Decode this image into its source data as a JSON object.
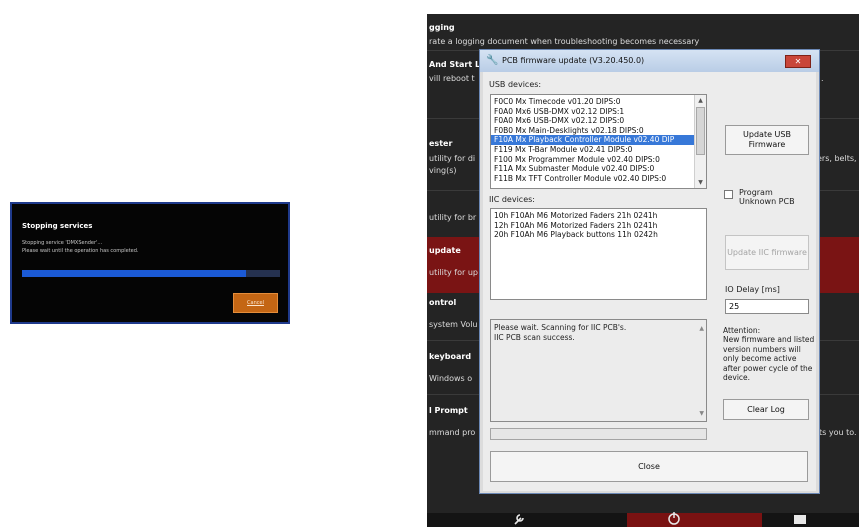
{
  "stopping_dialog": {
    "title": "Stopping services",
    "message_line1": "Stopping service 'DMXSender'...",
    "message_line2": "Please wait until the operation has completed.",
    "progress": 0.87,
    "cancel_label": "Cancel"
  },
  "settings": {
    "entries": [
      {
        "title": "gging",
        "desc": "rate a logging document when troubleshooting becomes necessary"
      },
      {
        "title": "And Start L",
        "desc": "vill reboot t"
      },
      {
        "title": "ester",
        "desc": "utility for di",
        "desc2": "ving(s)"
      },
      {
        "desc": "utility for br"
      },
      {
        "title": "update",
        "desc": "utility for up"
      },
      {
        "title": "ontrol",
        "desc": "system Volu"
      },
      {
        "title": "keyboard",
        "desc": "Windows o"
      },
      {
        "title": "l Prompt",
        "desc": "mmand pro"
      }
    ],
    "right_fragments": {
      "dot": ".",
      "faders": "ers, belts,",
      "you_to": "ts you to."
    },
    "taskbar": {
      "item1_icon": "wrench-icon",
      "item2_icon": "power-icon",
      "item3_icon": "keyboard-icon"
    }
  },
  "pcb_dialog": {
    "title": "PCB firmware update (V3.20.450.0)",
    "close_x": "✕",
    "usb_label": "USB devices:",
    "usb_devices": [
      "F0C0  Mx Timecode  v01.20  DIPS:0",
      "F0A0  Mx6 USB-DMX  v02.12  DIPS:1",
      "F0A0  Mx6 USB-DMX  v02.12  DIPS:0",
      "F0B0  Mx Main-Desklights  v02.18  DIPS:0",
      "F10A  Mx Playback Controller Module  v02.40  DIP",
      "F119  Mx T-Bar Module  v02.41  DIPS:0",
      "F100  Mx Programmer Module  v02.40  DIPS:0",
      "F11A  Mx Submaster Module  v02.40  DIPS:0",
      "F11B  Mx TFT Controller Module  v02.40  DIPS:0"
    ],
    "usb_selected_index": 4,
    "update_usb_label_1": "Update USB",
    "update_usb_label_2": "Firmware",
    "program_unknown_label_1": "Program",
    "program_unknown_label_2": "Unknown PCB",
    "iic_label": "IIC devices:",
    "iic_devices": [
      "10h  F10Ah  M6 Motorized Faders 21h  0241h",
      "12h  F10Ah  M6 Motorized Faders 21h  0241h",
      "20h  F10Ah  M6 Playback buttons 11h  0242h"
    ],
    "update_iic_label": "Update IIC firmware",
    "io_delay_label": "IO Delay [ms]",
    "io_delay_value": "25",
    "log_line1": "Please wait. Scanning for IIC PCB's.",
    "log_line2": "IIC PCB scan success.",
    "attention_title": "Attention:",
    "attention_text": "New firmware and listed version numbers will only become active after power cycle of the device.",
    "clear_log_label": "Clear Log",
    "close_label": "Close"
  }
}
